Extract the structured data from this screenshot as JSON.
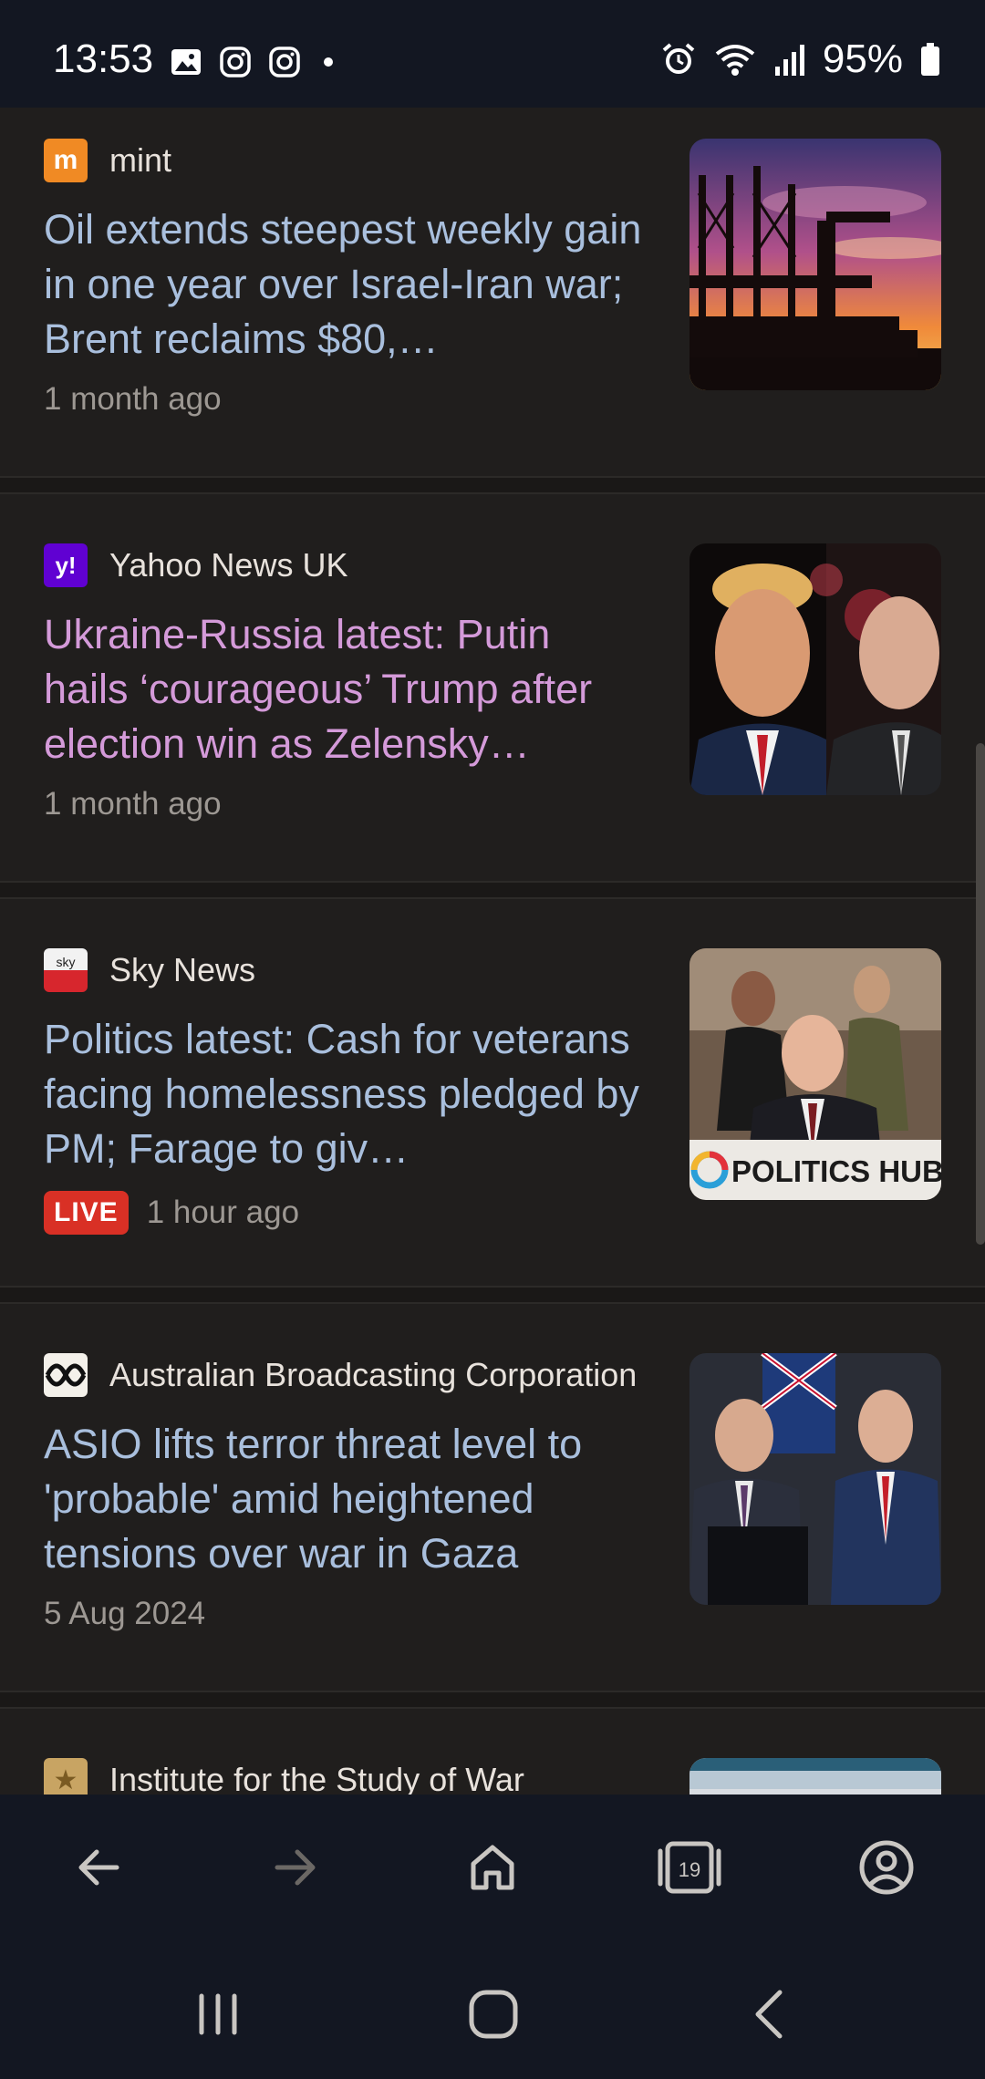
{
  "status": {
    "time": "13:53",
    "battery": "95%",
    "icons": [
      "gallery-icon",
      "instagram-icon",
      "instagram-icon",
      "dot-icon",
      "alarm-icon",
      "wifi-icon",
      "signal-icon",
      "battery-icon"
    ]
  },
  "feed": [
    {
      "source": "mint",
      "logo_text": "m",
      "headline": "Oil extends steepest weekly gain in one year over Israel-Iran war; Brent reclaims $80,…",
      "time": "1 month ago",
      "visited": false,
      "live": false
    },
    {
      "source": "Yahoo News UK",
      "logo_text": "y!",
      "headline": "Ukraine-Russia latest: Putin hails ‘courageous’ Trump after election win as Zelensky…",
      "time": "1 month ago",
      "visited": true,
      "live": false
    },
    {
      "source": "Sky News",
      "logo_text": "sky",
      "headline": "Politics latest: Cash for veterans facing homelessness pledged by PM; Farage to giv…",
      "time": "1 hour ago",
      "visited": false,
      "live": true,
      "live_label": "LIVE",
      "thumb_caption": "POLITICS HUB"
    },
    {
      "source": "Australian Broadcasting Corporation",
      "logo_text": "abc",
      "headline": "ASIO lifts terror threat level to 'probable' amid heightened tensions over war in Gaza",
      "time": "5 Aug 2024",
      "visited": false,
      "live": false
    },
    {
      "source": "Institute for the Study of War",
      "logo_text": "★",
      "headline": "",
      "time": "",
      "visited": false,
      "live": false
    }
  ],
  "toolbar": {
    "tab_count": "19",
    "icons": [
      "back-arrow-icon",
      "forward-arrow-icon",
      "home-icon",
      "tabs-icon",
      "account-icon"
    ]
  },
  "navbar": {
    "icons": [
      "recents-icon",
      "home-circle-icon",
      "back-chevron-icon"
    ]
  },
  "colors": {
    "headline": "#a9bfdd",
    "headline_visited": "#d49ad9",
    "live": "#d93025",
    "background": "#201e1d",
    "bars": "#131722"
  }
}
